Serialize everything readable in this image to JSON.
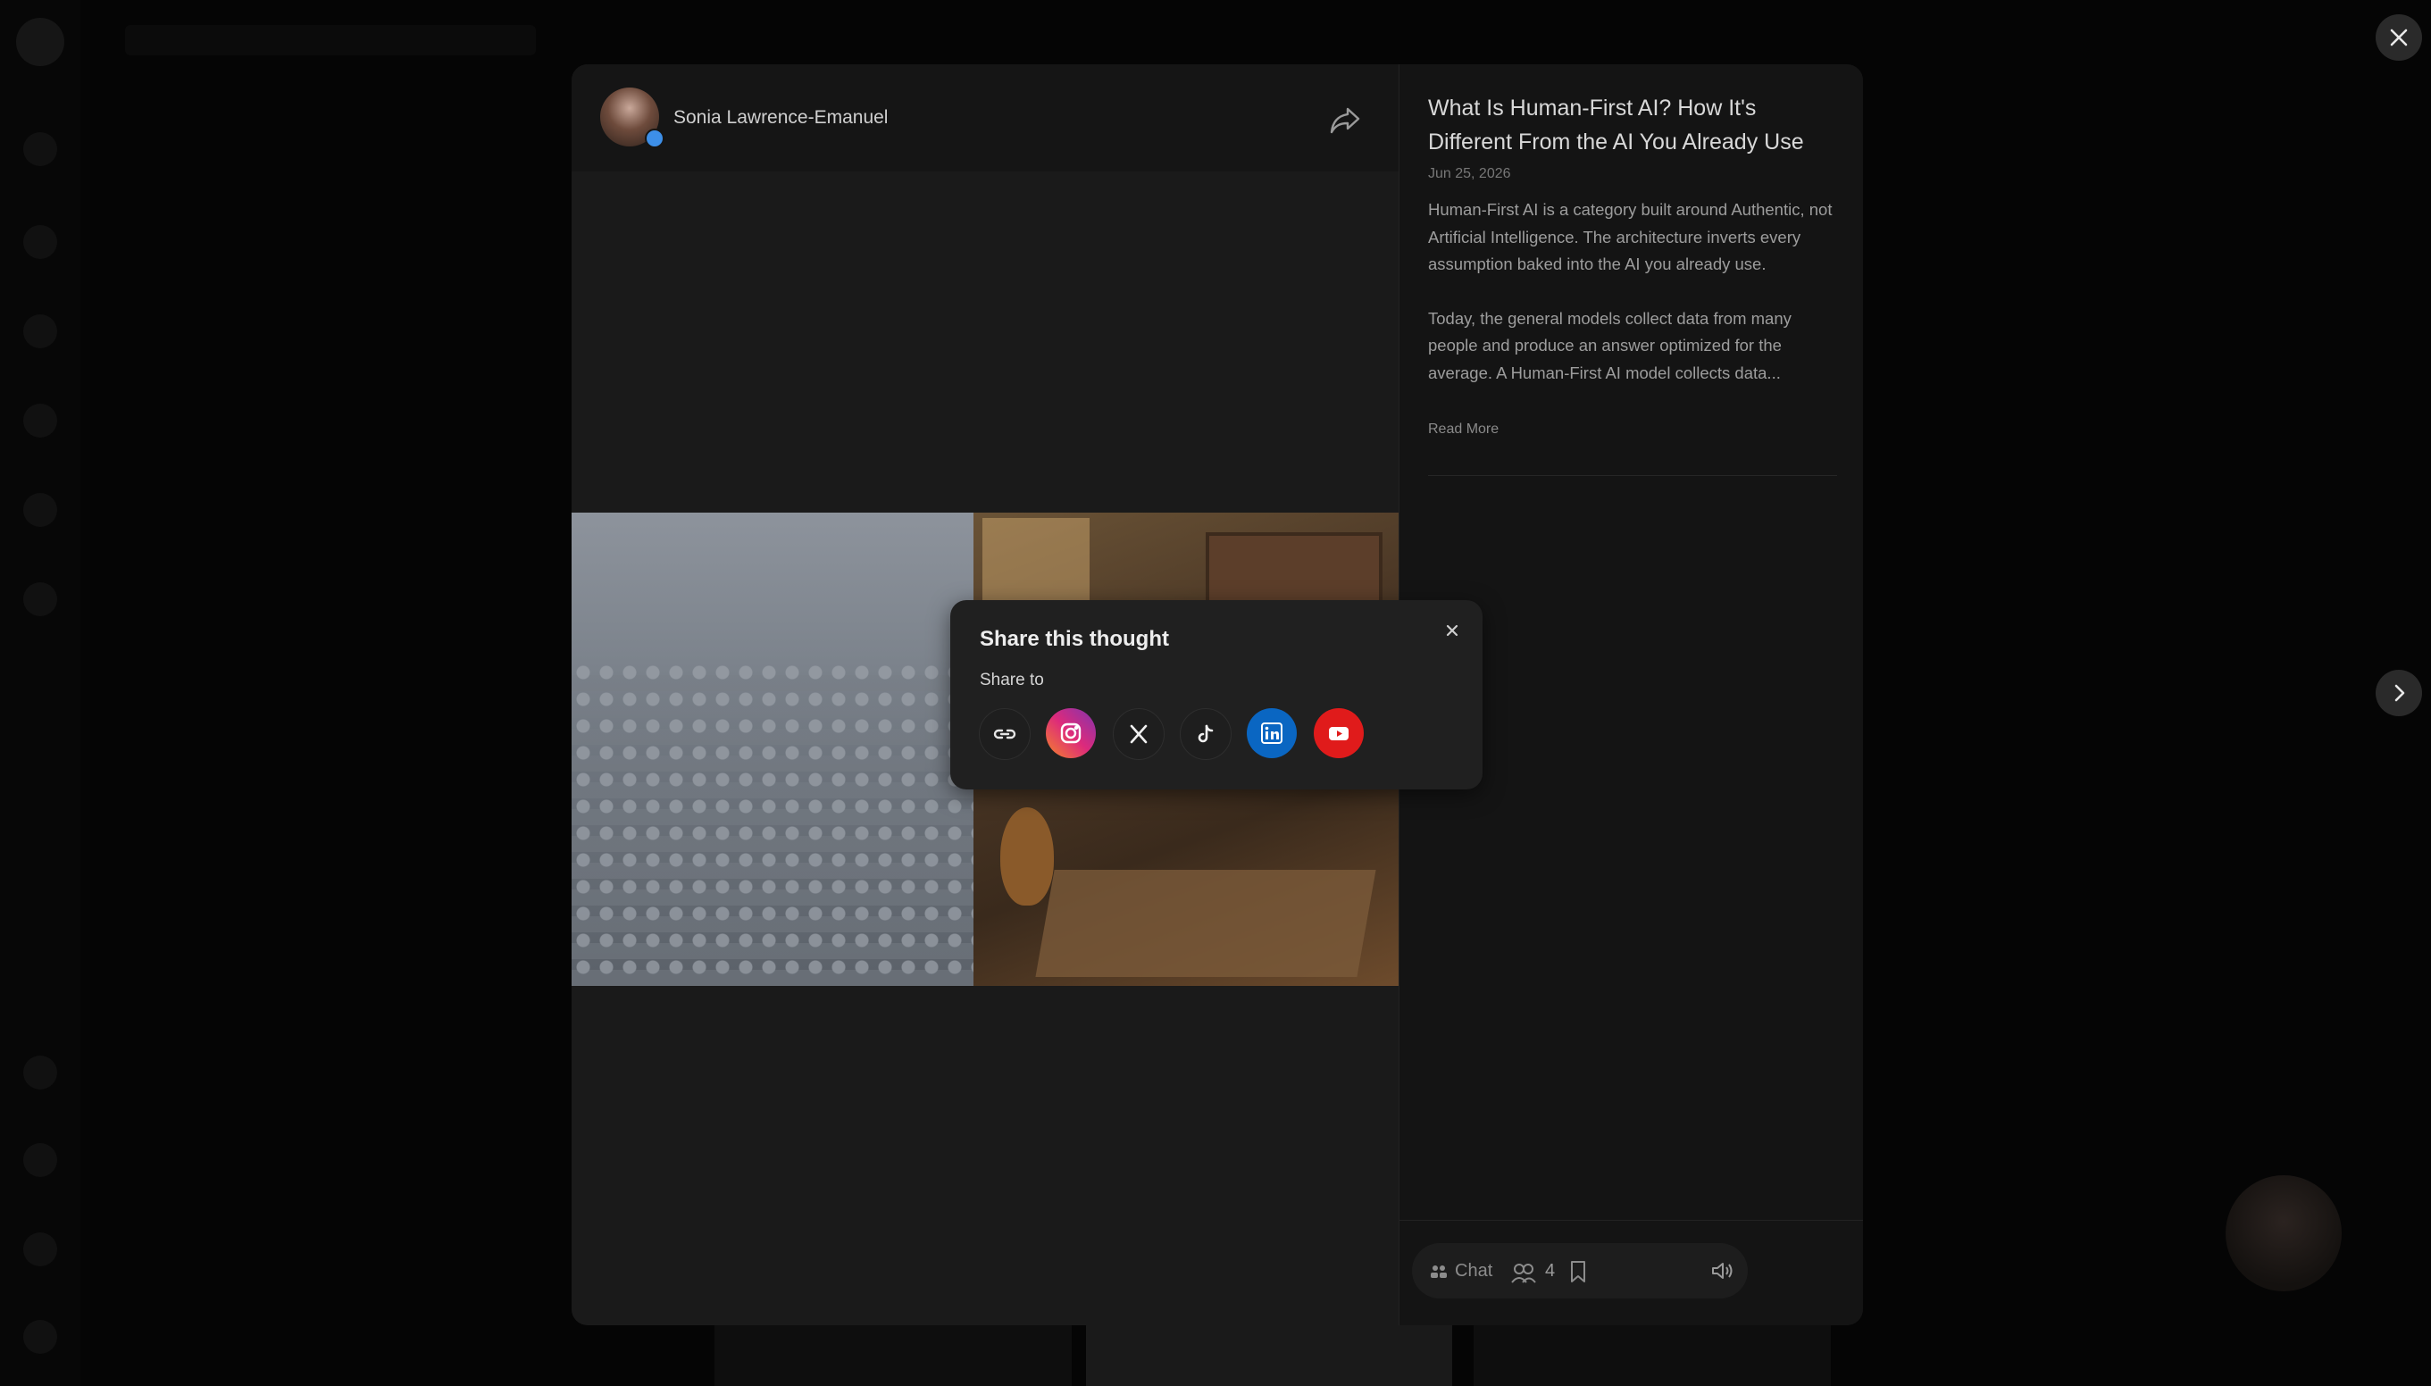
{
  "author": {
    "name": "Sonia Lawrence-Emanuel"
  },
  "post": {
    "title": "What Is Human-First AI? How It's Different From the AI You Already Use",
    "date": "Jun 25, 2026",
    "paragraphs": [
      "Human-First AI is a  category built around Authentic, not Artificial Intelligence. The architecture inverts every assumption baked into the AI you already use.",
      "Today, the general models collect data from many people and produce an answer optimized for the average. A Human-First AI model collects data..."
    ],
    "read_more": "Read More"
  },
  "footer": {
    "chat_label": "Chat",
    "reaction_count": "4"
  },
  "share_popup": {
    "title": "Share this thought",
    "subtitle": "Share to",
    "targets": [
      {
        "name": "copy-link",
        "icon": "link-icon",
        "color": "#1e1e1e"
      },
      {
        "name": "instagram",
        "icon": "instagram-icon",
        "color": "#e1306c"
      },
      {
        "name": "x",
        "icon": "x-icon",
        "color": "#1e1e1e"
      },
      {
        "name": "tiktok",
        "icon": "tiktok-icon",
        "color": "#1e1e1e"
      },
      {
        "name": "linkedin",
        "icon": "linkedin-icon",
        "color": "#0a66c2"
      },
      {
        "name": "youtube",
        "icon": "youtube-icon",
        "color": "#e01b1b"
      }
    ]
  }
}
